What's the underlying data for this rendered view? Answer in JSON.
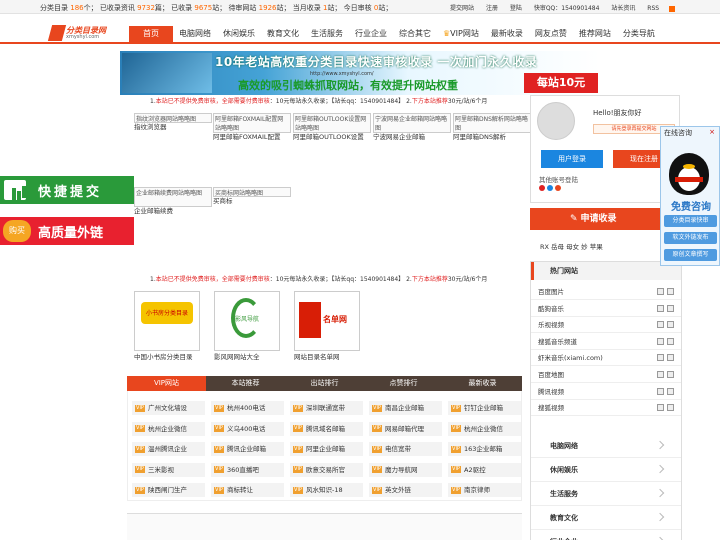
{
  "topbar": {
    "stats": [
      {
        "label": "分类目录",
        "num": "186",
        "unit": "个；"
      },
      {
        "label": "已收录资讯",
        "num": "9732",
        "unit": "篇；"
      },
      {
        "label": "已收录",
        "num": "9675",
        "unit": "站；"
      },
      {
        "label": "待审网站",
        "num": "1926",
        "unit": "站；"
      },
      {
        "label": "当月收录",
        "num": "1",
        "unit": "站；"
      },
      {
        "label": "今日审核",
        "num": "0",
        "unit": "站；"
      }
    ],
    "links": [
      "提交网站",
      "注册",
      "登陆",
      "快审QQ：1540901484",
      "站长资讯",
      "RSS"
    ]
  },
  "logo": {
    "title": "分类目录网",
    "domain": "xmyshyl.com"
  },
  "nav": [
    "首页",
    "电脑网络",
    "休闲娱乐",
    "教育文化",
    "生活服务",
    "行业企业",
    "综合其它",
    "VIP网站",
    "最新收录",
    "网友点赞",
    "推荐网站",
    "分类导航"
  ],
  "banner": {
    "line1a": "10年老站高权重分类目录快速审核收录",
    "line1b": "一次加门永久收录",
    "url": "http://www.xmyshyl.com/",
    "line2": "高效的吸引蜘蛛抓取网站，有效提升网站权重",
    "price": "每站10元"
  },
  "notice": {
    "n1": "1.",
    "red": "本站已不提供免费审核，全部需要付费审核",
    "mid": "：10元每站永久收录；【站长qq：1540901484】 2.",
    "red2": "下方本站推荐",
    "tail": "30元/站/6个月"
  },
  "thumbs": [
    {
      "alt": "指纹浏览器网站略略图",
      "cap": "指纹浏览器"
    },
    {
      "alt": "阿里邮箱FOXMAIL配置网站略略图",
      "cap": "阿里邮箱FOXMAIL配置"
    },
    {
      "alt": "阿里邮箱OUTLOOK设置网站略略图",
      "cap": "阿里邮箱OUTLOOK设置"
    },
    {
      "alt": "宁波网易企业邮箱网站略略图",
      "cap": "宁波网易企业邮箱"
    },
    {
      "alt": "阿里邮箱DNS解析网站略略图",
      "cap": "阿里邮箱DNS解析"
    },
    {
      "alt": "企业邮箱续费网站略略图",
      "cap": "企业邮箱续费"
    },
    {
      "alt": "买商标网站略略图",
      "cap": "买商标"
    }
  ],
  "logos": [
    {
      "name": "中国小书房分类目录",
      "mark": "小书房分类目录"
    },
    {
      "name": "影风网网站大全",
      "mark": "影风导航"
    },
    {
      "name": "网站目录名单网",
      "mark": "名单网"
    }
  ],
  "tabs": [
    "VIP网站",
    "本站推荐",
    "出站排行",
    "点赞排行",
    "最新收录"
  ],
  "grid": [
    "广州文化墙设",
    "杭州400电话",
    "深圳联通宽带",
    "南昌企业邮箱",
    "钉钉企业邮箱",
    "杭州企业微信",
    "义乌400电话",
    "腾讯域名邮箱",
    "网易邮箱代理",
    "杭州企业微信",
    "温州腾讯企业",
    "腾讯企业邮箱",
    "阿里企业邮箱",
    "电信宽带",
    "163企业邮箱",
    "三米影视",
    "360直播吧",
    "欧意交易所官",
    "魔力导航网",
    "A2驱控",
    "陕西闸门生产",
    "商标转让",
    "风水知识-18",
    "英文外链",
    "南京律师"
  ],
  "vip": "VIP",
  "user": {
    "hello": "Hello!朋友你好",
    "hint": "请先登录再提交网站",
    "login": "用户登录",
    "register": "现在注册",
    "other": "其他账号登陆"
  },
  "apply": "申请收录",
  "rx": "RX 岳母 母女 妙 苹果",
  "hot": {
    "title": "热门网站",
    "items": [
      "百度图片",
      "酷狗音乐",
      "乐视视频",
      "搜狐音乐频道",
      "虾米音乐(xiami.com)",
      "百度地图",
      "腾讯视频",
      "搜狐视频"
    ]
  },
  "cats": [
    "电脑网络",
    "休闲娱乐",
    "生活服务",
    "教育文化",
    "行业企业"
  ],
  "qq": {
    "head": "在线咨询",
    "close": "×",
    "free": "免费咨询",
    "btns": [
      "分类目录快审",
      "软文外链发布",
      "原创文章撰写"
    ]
  },
  "side": {
    "b1": "快捷提交",
    "b2icon": "购买",
    "b2": "高质量外链"
  },
  "colors": {
    "accent": "#e8461e",
    "green": "#2a9a3a",
    "red": "#e8212f",
    "blue": "#1b86e0"
  }
}
